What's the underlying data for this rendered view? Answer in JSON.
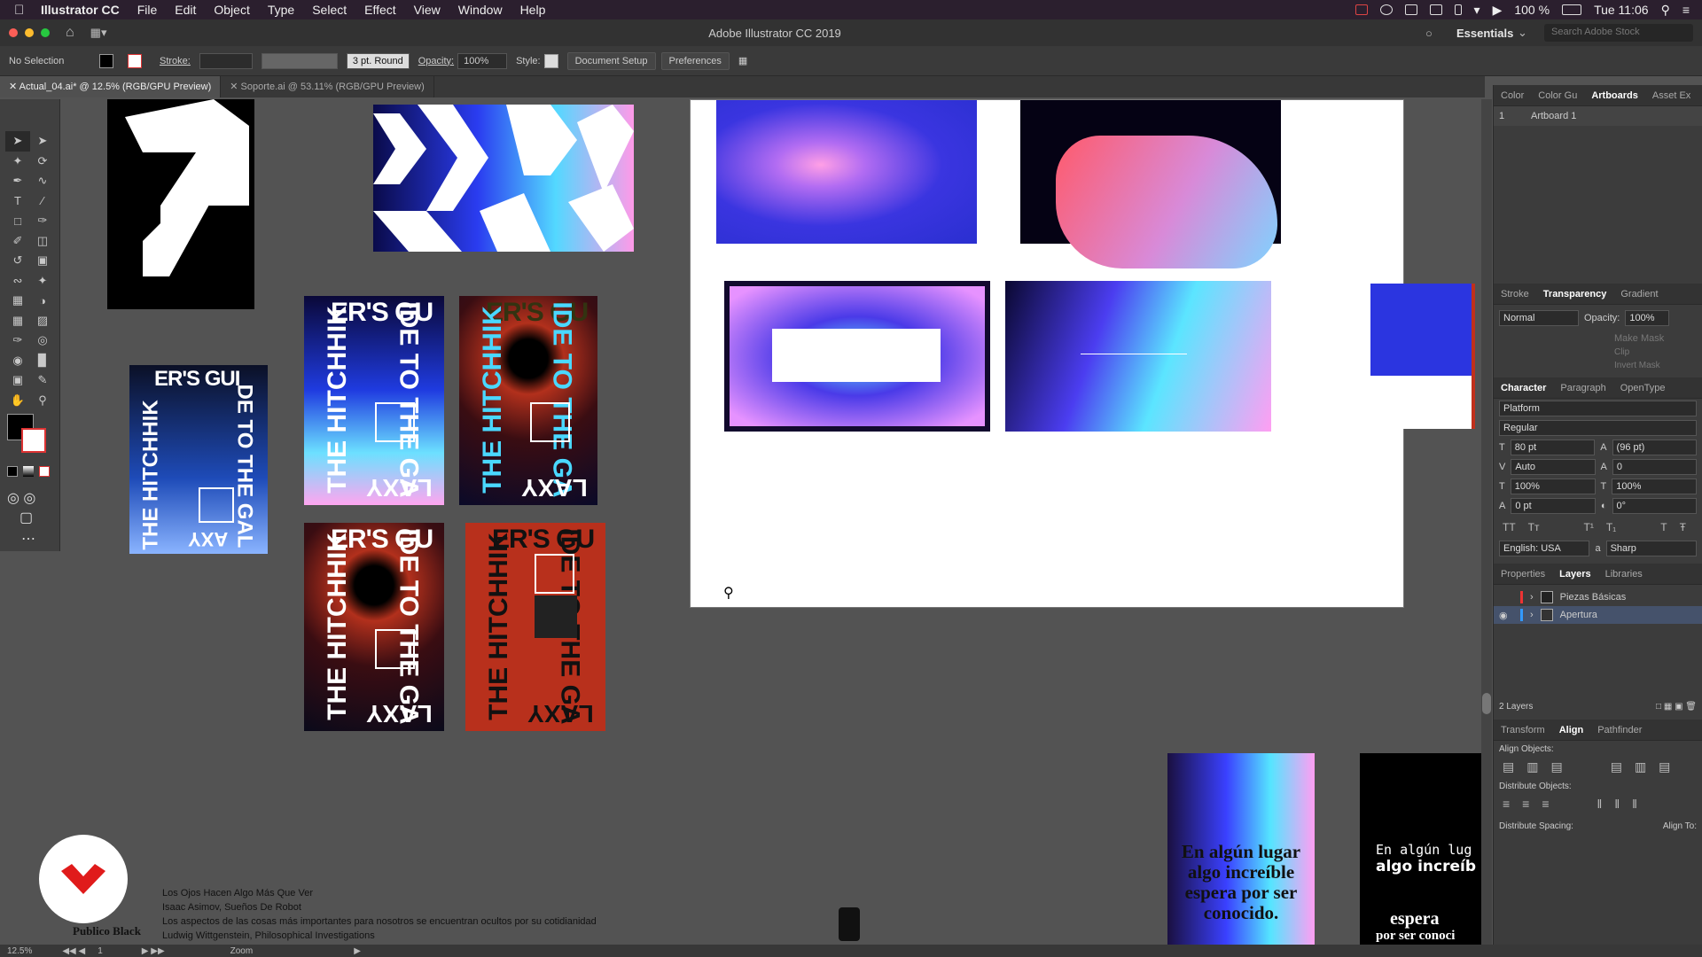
{
  "menubar": {
    "app": "Illustrator CC",
    "items": [
      "File",
      "Edit",
      "Object",
      "Type",
      "Select",
      "Effect",
      "View",
      "Window",
      "Help"
    ],
    "battery": "100 %",
    "clock": "Tue 11:06"
  },
  "titlebar": {
    "title": "Adobe Illustrator CC 2019",
    "workspace": "Essentials",
    "search_placeholder": "Search Adobe Stock"
  },
  "control": {
    "selection": "No Selection",
    "stroke_label": "Stroke:",
    "brush": "3 pt. Round",
    "opacity_label": "Opacity:",
    "opacity": "100%",
    "style_label": "Style:",
    "doc_setup": "Document Setup",
    "preferences": "Preferences"
  },
  "tabs": [
    {
      "label": "Actual_04.ai* @ 12.5% (RGB/GPU Preview)"
    },
    {
      "label": "Soporte.ai @ 53.11% (RGB/GPU Preview)"
    }
  ],
  "panels": {
    "top_tabs": [
      "Color",
      "Color Gu",
      "Artboards",
      "Asset Ex"
    ],
    "artboard_row": {
      "num": "1",
      "name": "Artboard 1"
    },
    "trans_tabs": [
      "Stroke",
      "Transparency",
      "Gradient"
    ],
    "blend": "Normal",
    "opacity_label": "Opacity:",
    "opacity": "100%",
    "make_mask": "Make Mask",
    "clip": "Clip",
    "invert": "Invert Mask",
    "char_tabs": [
      "Character",
      "Paragraph",
      "OpenType"
    ],
    "font": "Platform",
    "style": "Regular",
    "size": "80 pt",
    "leading": "(96 pt)",
    "kerning": "Auto",
    "tracking": "0",
    "vscale": "100%",
    "hscale": "100%",
    "baseline": "0 pt",
    "rotate": "0°",
    "language": "English: USA",
    "aa": "Sharp",
    "layer_tabs": [
      "Properties",
      "Layers",
      "Libraries"
    ],
    "layers": [
      "Piezas Básicas",
      "Apertura"
    ],
    "layer_count": "2 Layers",
    "align_tabs": [
      "Transform",
      "Align",
      "Pathfinder"
    ],
    "align_objects": "Align Objects:",
    "distribute_objects": "Distribute Objects:",
    "distribute_spacing": "Distribute Spacing:",
    "align_to": "Align To:"
  },
  "posters": {
    "t1": "ER'S GU",
    "t2": "THE HITCHHIK",
    "t3": "IDE TO THE GA",
    "t4": "LAXY",
    "t3b": "DE TO THE GAL",
    "t1b": "ER'S GUI",
    "t4b": "AXY"
  },
  "spanish": {
    "a": "En algún lugar algo increíble espera por ser conocido.",
    "b1": "En algún lug",
    "b2": "algo increíb",
    "b3": "espera",
    "b4": "por ser conoci"
  },
  "captions": [
    "Los Ojos Hacen Algo Más Que Ver",
    "Isaac Asimov, Sueños De Robot",
    "Los aspectos de las cosas más importantes para nosotros se encuentran ocultos por su cotidianidad",
    "Ludwig Wittgenstein, Philosophical Investigations"
  ],
  "publico": "Publico Black",
  "status": {
    "zoom": "12.5%",
    "page": "1",
    "mode": "Zoom"
  }
}
